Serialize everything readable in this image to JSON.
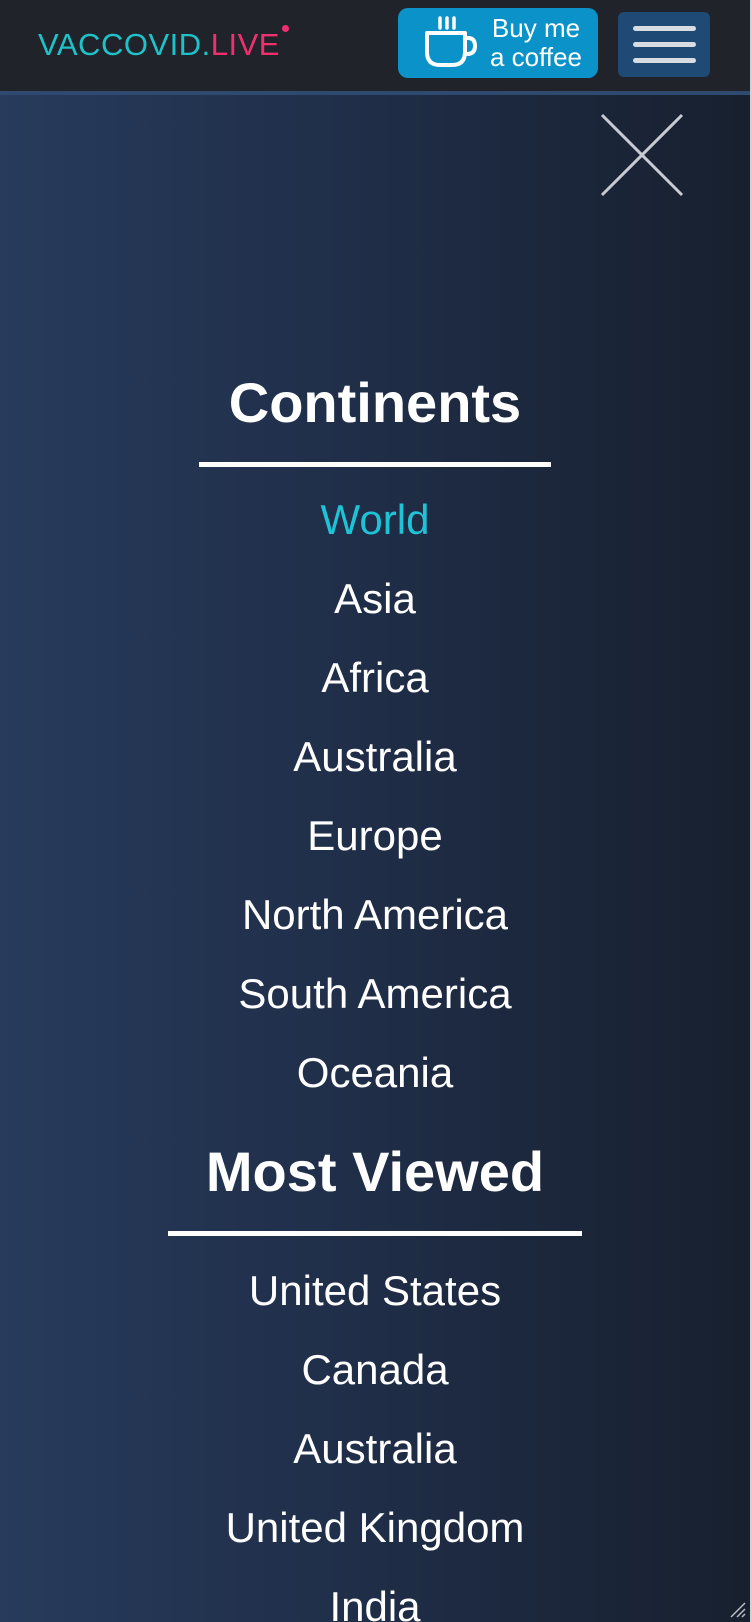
{
  "header": {
    "logo_main": "VACCOVID.",
    "logo_accent": "LIVE",
    "coffee_line1": "Buy me",
    "coffee_line2": "a coffee",
    "menu_icon": "hamburger-icon",
    "coffee_icon": "coffee-cup-icon"
  },
  "nav": {
    "close_icon": "close-icon",
    "continents_title": "Continents",
    "continents": [
      {
        "label": "World",
        "active": true
      },
      {
        "label": "Asia",
        "active": false
      },
      {
        "label": "Africa",
        "active": false
      },
      {
        "label": "Australia",
        "active": false
      },
      {
        "label": "Europe",
        "active": false
      },
      {
        "label": "North America",
        "active": false
      },
      {
        "label": "South America",
        "active": false
      },
      {
        "label": "Oceania",
        "active": false
      }
    ],
    "most_viewed_title": "Most Viewed",
    "most_viewed": [
      {
        "label": "United States"
      },
      {
        "label": "Canada"
      },
      {
        "label": "Australia"
      },
      {
        "label": "United Kingdom"
      },
      {
        "label": "India"
      }
    ]
  },
  "colors": {
    "logo_teal": "#1ec3c9",
    "logo_pink": "#f0306e",
    "active_link": "#1ec3d6",
    "coffee_button": "#0a92c9",
    "menu_button": "#1e4a75",
    "topbar": "#20242a"
  }
}
